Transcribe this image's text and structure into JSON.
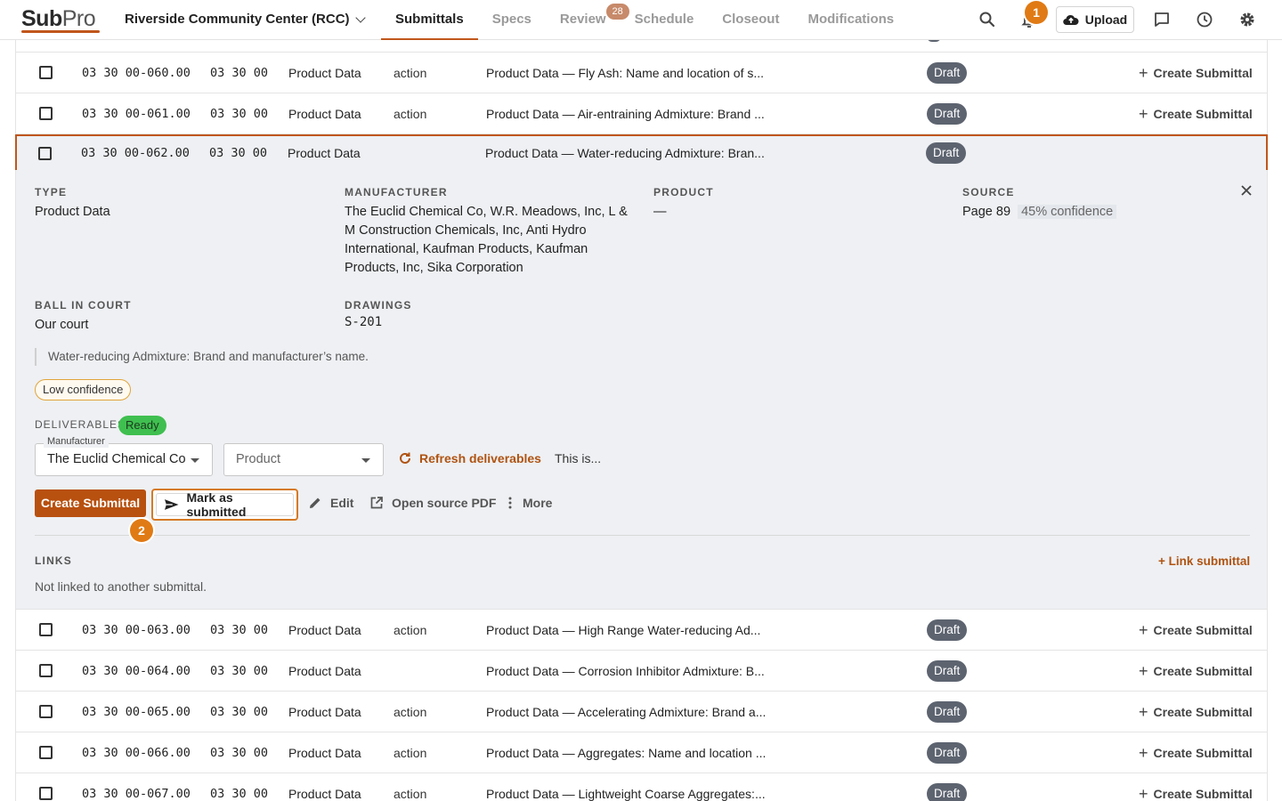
{
  "header": {
    "logo_main": "Sub",
    "logo_accent": "Pro",
    "project": "Riverside Community Center (RCC)",
    "tabs": [
      {
        "label": "Submittals",
        "active": true
      },
      {
        "label": "Specs"
      },
      {
        "label": "Review",
        "count": "28"
      },
      {
        "label": "Schedule"
      },
      {
        "label": "Closeout"
      },
      {
        "label": "Modifications"
      }
    ],
    "notification_badge": "1",
    "upload_label": "Upload"
  },
  "rows_above": [
    {
      "id": "03 30 00-060.00",
      "section": "03 30 00",
      "type": "Product Data",
      "action": "action",
      "title": "Product Data — Fly Ash: Name and location of s...",
      "status": "Draft",
      "create_label": "Create Submittal"
    },
    {
      "id": "03 30 00-061.00",
      "section": "03 30 00",
      "type": "Product Data",
      "action": "action",
      "title": "Product Data — Air-entraining Admixture: Brand ...",
      "status": "Draft",
      "create_label": "Create Submittal"
    },
    {
      "id": "03 30 00-062.00",
      "section": "03 30 00",
      "type": "Product Data",
      "action": "",
      "title": "Product Data — Water-reducing Admixture: Bran...",
      "status": "Draft",
      "create_label": ""
    }
  ],
  "detail": {
    "type_label": "TYPE",
    "type_value": "Product Data",
    "manufacturer_label": "MANUFACTURER",
    "manufacturer_lines": [
      "The Euclid Chemical Co, W.R. Meadows, Inc, L &",
      "M Construction Chemicals, Inc, Anti Hydro",
      "International, Kaufman Products, Kaufman",
      "Products, Inc, Sika Corporation"
    ],
    "product_label": "PRODUCT",
    "product_value": "—",
    "source_label": "SOURCE",
    "source_page": "Page 89",
    "source_confidence": "45% confidence",
    "ball_label": "BALL IN COURT",
    "ball_value": "Our court",
    "drawings_label": "DRAWINGS",
    "drawings_value": "S-201",
    "quote": "Water-reducing Admixture: Brand and manufacturer’s name.",
    "low_confidence": "Low confidence",
    "deliverables_label": "DELIVERABLES",
    "deliverables_status": "Ready",
    "manufacturer_select_legend": "Manufacturer",
    "manufacturer_select_value": "The Euclid Chemical Co",
    "product_select_placeholder": "Product",
    "refresh_label": "Refresh deliverables",
    "truncated_text": "This is...",
    "create_submittal_btn": "Create Submittal",
    "mark_submitted_btn": "Mark as submitted",
    "edit_label": "Edit",
    "open_pdf_label": "Open source PDF",
    "more_label": "More",
    "step_badge": "2",
    "links_label": "LINKS",
    "link_submittal_label": "+ Link submittal",
    "not_linked_text": "Not linked to another submittal."
  },
  "rows_below": [
    {
      "id": "03 30 00-063.00",
      "section": "03 30 00",
      "type": "Product Data",
      "action": "action",
      "title": "Product Data — High Range Water-reducing Ad...",
      "status": "Draft",
      "create_label": "Create Submittal"
    },
    {
      "id": "03 30 00-064.00",
      "section": "03 30 00",
      "type": "Product Data",
      "action": "",
      "title": "Product Data — Corrosion Inhibitor Admixture: B...",
      "status": "Draft",
      "create_label": "Create Submittal"
    },
    {
      "id": "03 30 00-065.00",
      "section": "03 30 00",
      "type": "Product Data",
      "action": "action",
      "title": "Product Data — Accelerating Admixture: Brand a...",
      "status": "Draft",
      "create_label": "Create Submittal"
    },
    {
      "id": "03 30 00-066.00",
      "section": "03 30 00",
      "type": "Product Data",
      "action": "action",
      "title": "Product Data — Aggregates: Name and location ...",
      "status": "Draft",
      "create_label": "Create Submittal"
    },
    {
      "id": "03 30 00-067.00",
      "section": "03 30 00",
      "type": "Product Data",
      "action": "action",
      "title": "Product Data — Lightweight Coarse Aggregates:...",
      "status": "Draft",
      "create_label": "Create Submittal"
    }
  ],
  "colors": {
    "accent": "#c0561b",
    "draft_badge": "#5d6470",
    "ready_badge": "#3fbf4f",
    "step_badge": "#e07a14"
  },
  "icons": [
    "search-icon",
    "bell-icon",
    "cloud-upload-icon",
    "chat-icon",
    "clock-icon",
    "gear-icon",
    "close-icon",
    "refresh-icon",
    "send-icon",
    "pencil-icon",
    "external-link-icon",
    "more-vertical-icon",
    "plus-icon",
    "chevron-down-icon"
  ]
}
